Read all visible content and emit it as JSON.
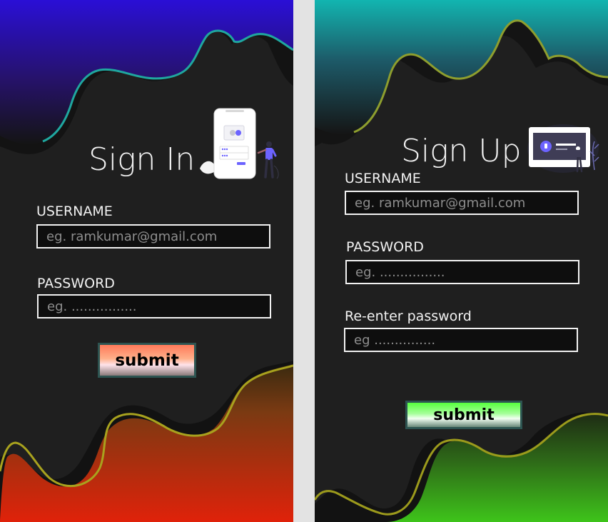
{
  "signin": {
    "title": "Sign In",
    "username_label": "USERNAME",
    "username_placeholder": "eg. ramkumar@gmail.com",
    "password_label": "PASSWORD",
    "password_placeholder": "eg. ................",
    "submit_label": "submit",
    "colors": {
      "top_wave": "#2a0fd6",
      "bottom_wave_top": "#e0a400",
      "bottom_wave_bottom": "#e0220a",
      "button_top": "#ff7a5a",
      "button_bottom": "#ffe0e8"
    }
  },
  "signup": {
    "title": "Sign Up",
    "username_label": "USERNAME",
    "username_placeholder": "eg. ramkumar@gmail.com",
    "password_label": "PASSWORD",
    "password_placeholder": "eg. ................",
    "reenter_label": "Re-enter password",
    "reenter_placeholder": "eg ...............",
    "submit_label": "submit",
    "colors": {
      "top_wave": "#12b5b0",
      "bottom_wave": "#3ec41a",
      "button_top": "#56ff3e",
      "button_bottom": "#f0fff0"
    }
  }
}
